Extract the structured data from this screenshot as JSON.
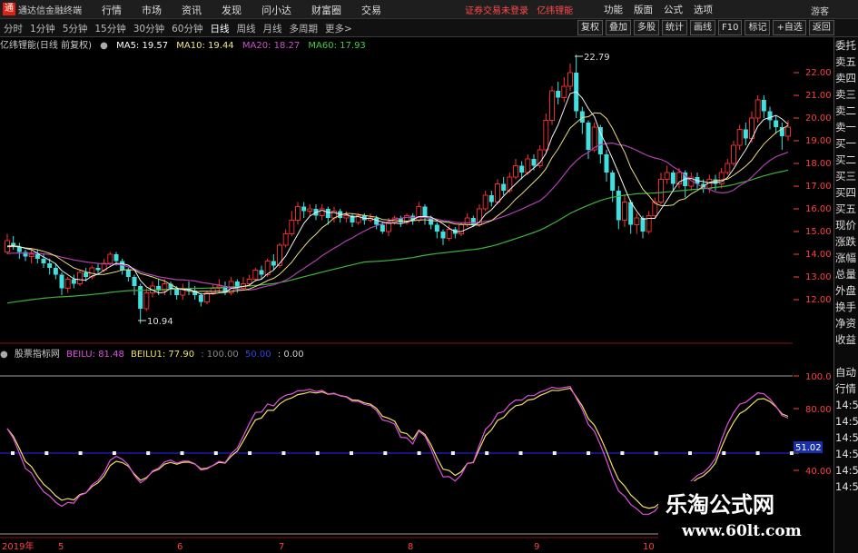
{
  "window": {
    "app_title": "通达信金融终端",
    "menus": [
      "行情",
      "市场",
      "资讯",
      "发现",
      "问小达",
      "财富圈",
      "交易"
    ],
    "warning": "证券交易未登录",
    "stock_name": "亿纬锂能",
    "right_menus": [
      "功能",
      "版面",
      "公式",
      "选项"
    ],
    "guest": "游客"
  },
  "toolbar": {
    "periods": [
      "分时",
      "1分钟",
      "5分钟",
      "15分钟",
      "30分钟",
      "60分钟",
      "日线",
      "周线",
      "月线",
      "多周期",
      "更多>"
    ],
    "active_period": "日线",
    "tools": [
      "复权",
      "叠加",
      "多股",
      "统计",
      "画线",
      "F10",
      "标记",
      "+自选",
      "返回"
    ]
  },
  "main_header": {
    "title": "亿纬锂能(日线 前复权)",
    "ma5": "MA5: 19.57",
    "ma10": "MA10: 19.44",
    "ma20": "MA20: 18.27",
    "ma60": "MA60: 17.93",
    "colors": {
      "ma5": "#ffffff",
      "ma10": "#f0e68c",
      "ma20": "#c040c0",
      "ma60": "#40c040"
    }
  },
  "price_axis": [
    "22.00",
    "21.00",
    "20.00",
    "19.00",
    "18.00",
    "17.00",
    "16.00",
    "15.00",
    "14.00",
    "13.00",
    "12.00"
  ],
  "price_labels": {
    "high": "22.79",
    "low": "10.94"
  },
  "indicator_header": {
    "name": "股票指标网",
    "beilu": "BEILU: 81.48",
    "beilu1": "BEILU1: 77.90",
    "v100": ": 100.00",
    "v50": "50.00",
    "v0": ": 0.00"
  },
  "indicator_axis": [
    "100.0",
    "80.00",
    "51.02",
    "40.00"
  ],
  "date_axis": [
    "2019年",
    "5",
    "6",
    "7",
    "8",
    "9",
    "10"
  ],
  "right_panel": [
    "委托",
    "卖五",
    "卖四",
    "卖三",
    "卖二",
    "卖一",
    "买一",
    "买二",
    "买三",
    "买四",
    "买五",
    "现价",
    "涨跌",
    "涨幅",
    "总量",
    "外盘",
    "换手",
    "净资",
    "收益",
    "",
    "自动",
    "行情",
    "14:50",
    "14:50",
    "14:50",
    "14:50",
    "14:50",
    "14:50",
    "14:50",
    "14:50"
  ],
  "watermark": {
    "line1": "乐淘公式网",
    "line2": "www.60lt.com"
  },
  "chart_data": {
    "type": "candlestick",
    "y_range": [
      11.3,
      23.0
    ],
    "candles": [
      [
        14.1,
        14.6,
        14.9,
        14.0
      ],
      [
        14.5,
        14.4,
        14.8,
        14.2
      ],
      [
        14.3,
        14.1,
        14.5,
        13.8
      ],
      [
        14.1,
        13.9,
        14.2,
        13.7
      ],
      [
        13.9,
        14.0,
        14.2,
        13.6
      ],
      [
        14.0,
        13.8,
        14.2,
        13.6
      ],
      [
        13.8,
        13.6,
        14.0,
        13.4
      ],
      [
        13.6,
        13.4,
        13.8,
        13.1
      ],
      [
        13.4,
        13.1,
        13.6,
        12.9
      ],
      [
        13.1,
        12.5,
        13.2,
        12.2
      ],
      [
        12.5,
        12.9,
        13.0,
        12.3
      ],
      [
        12.9,
        12.7,
        13.1,
        12.5
      ],
      [
        12.7,
        13.2,
        13.3,
        12.6
      ],
      [
        13.2,
        13.0,
        13.4,
        12.8
      ],
      [
        13.0,
        13.4,
        13.5,
        12.9
      ],
      [
        13.4,
        13.3,
        13.6,
        13.1
      ],
      [
        13.3,
        13.6,
        13.8,
        13.2
      ],
      [
        13.6,
        14.0,
        14.1,
        13.5
      ],
      [
        14.0,
        13.7,
        14.1,
        13.5
      ],
      [
        13.7,
        13.3,
        13.8,
        13.1
      ],
      [
        13.3,
        13.0,
        13.4,
        12.8
      ],
      [
        13.0,
        12.6,
        13.1,
        12.2
      ],
      [
        12.6,
        11.6,
        12.7,
        10.94
      ],
      [
        11.6,
        12.3,
        12.5,
        11.5
      ],
      [
        12.3,
        12.6,
        12.8,
        12.1
      ],
      [
        12.6,
        12.4,
        12.9,
        12.2
      ],
      [
        12.4,
        12.7,
        12.9,
        12.2
      ],
      [
        12.7,
        12.5,
        12.8,
        12.2
      ],
      [
        12.5,
        12.2,
        12.6,
        12.0
      ],
      [
        12.2,
        12.5,
        12.7,
        12.0
      ],
      [
        12.5,
        12.4,
        12.8,
        12.2
      ],
      [
        12.4,
        12.2,
        12.6,
        12.0
      ],
      [
        12.2,
        11.9,
        12.3,
        11.7
      ],
      [
        11.9,
        12.3,
        12.4,
        11.8
      ],
      [
        12.3,
        12.5,
        12.7,
        12.2
      ],
      [
        12.5,
        12.6,
        12.9,
        12.3
      ],
      [
        12.6,
        12.3,
        12.8,
        12.2
      ],
      [
        12.3,
        12.8,
        13.0,
        12.2
      ],
      [
        12.8,
        12.5,
        12.9,
        12.3
      ],
      [
        12.5,
        12.7,
        13.0,
        12.4
      ],
      [
        12.7,
        12.9,
        13.1,
        12.6
      ],
      [
        12.9,
        13.3,
        13.4,
        12.8
      ],
      [
        13.3,
        13.1,
        13.5,
        12.9
      ],
      [
        13.1,
        13.7,
        13.8,
        13.0
      ],
      [
        13.7,
        13.5,
        14.0,
        13.3
      ],
      [
        13.5,
        14.4,
        14.5,
        13.4
      ],
      [
        14.4,
        14.9,
        15.1,
        14.3
      ],
      [
        14.9,
        15.5,
        15.9,
        14.8
      ],
      [
        15.5,
        16.1,
        16.3,
        15.3
      ],
      [
        16.1,
        15.9,
        16.3,
        15.6
      ],
      [
        15.9,
        16.0,
        16.2,
        15.7
      ],
      [
        16.0,
        15.7,
        16.2,
        15.5
      ],
      [
        15.7,
        16.0,
        16.2,
        15.5
      ],
      [
        16.0,
        15.6,
        16.1,
        15.3
      ],
      [
        15.6,
        15.9,
        16.1,
        15.4
      ],
      [
        15.9,
        15.6,
        16.0,
        15.4
      ],
      [
        15.6,
        15.7,
        15.9,
        15.4
      ],
      [
        15.7,
        15.4,
        15.8,
        15.2
      ],
      [
        15.4,
        15.7,
        15.8,
        15.3
      ],
      [
        15.7,
        15.5,
        15.8,
        15.3
      ],
      [
        15.5,
        15.6,
        15.8,
        15.4
      ],
      [
        15.6,
        15.3,
        15.7,
        15.1
      ],
      [
        15.3,
        15.0,
        15.4,
        14.9
      ],
      [
        15.0,
        15.4,
        15.6,
        14.8
      ],
      [
        15.4,
        15.6,
        15.7,
        15.3
      ],
      [
        15.6,
        15.4,
        15.7,
        15.2
      ],
      [
        15.4,
        15.7,
        15.8,
        15.3
      ],
      [
        15.7,
        15.5,
        15.8,
        15.3
      ],
      [
        15.5,
        16.1,
        16.3,
        15.4
      ],
      [
        16.1,
        15.6,
        16.2,
        15.3
      ],
      [
        15.6,
        15.3,
        15.7,
        15.1
      ],
      [
        15.3,
        15.0,
        15.4,
        14.7
      ],
      [
        15.0,
        14.7,
        15.1,
        14.4
      ],
      [
        14.7,
        15.1,
        15.3,
        14.6
      ],
      [
        15.1,
        14.9,
        15.2,
        14.7
      ],
      [
        14.9,
        15.3,
        15.4,
        14.8
      ],
      [
        15.3,
        15.6,
        15.8,
        15.2
      ],
      [
        15.6,
        15.3,
        15.7,
        15.2
      ],
      [
        15.3,
        16.0,
        16.2,
        15.2
      ],
      [
        16.0,
        16.6,
        16.8,
        15.9
      ],
      [
        16.6,
        16.3,
        16.8,
        16.1
      ],
      [
        16.3,
        17.1,
        17.3,
        16.2
      ],
      [
        17.1,
        16.8,
        17.4,
        16.6
      ],
      [
        16.8,
        17.4,
        17.6,
        16.7
      ],
      [
        17.4,
        17.9,
        18.2,
        17.3
      ],
      [
        17.9,
        17.6,
        18.1,
        17.3
      ],
      [
        17.6,
        18.2,
        18.4,
        17.5
      ],
      [
        18.2,
        17.9,
        18.4,
        17.7
      ],
      [
        17.9,
        18.6,
        18.8,
        17.8
      ],
      [
        18.6,
        19.9,
        20.2,
        18.5
      ],
      [
        19.9,
        21.2,
        21.4,
        19.7
      ],
      [
        21.2,
        20.9,
        21.6,
        20.6
      ],
      [
        20.9,
        21.4,
        21.8,
        20.7
      ],
      [
        21.4,
        22.0,
        22.4,
        21.2
      ],
      [
        22.0,
        20.3,
        22.79,
        20.0
      ],
      [
        20.3,
        19.8,
        20.5,
        19.3
      ],
      [
        19.8,
        18.6,
        19.9,
        18.2
      ],
      [
        18.6,
        19.6,
        19.8,
        18.5
      ],
      [
        19.6,
        18.4,
        19.7,
        18.0
      ],
      [
        18.4,
        17.6,
        18.6,
        17.2
      ],
      [
        17.6,
        16.8,
        17.7,
        16.3
      ],
      [
        16.8,
        15.5,
        17.0,
        15.1
      ],
      [
        15.5,
        16.3,
        16.6,
        15.2
      ],
      [
        16.3,
        15.3,
        16.4,
        14.9
      ],
      [
        15.3,
        15.6,
        15.8,
        14.9
      ],
      [
        15.6,
        15.0,
        15.7,
        14.7
      ],
      [
        15.0,
        15.7,
        15.9,
        14.9
      ],
      [
        15.7,
        16.3,
        16.5,
        15.6
      ],
      [
        16.3,
        17.3,
        17.6,
        16.2
      ],
      [
        17.3,
        17.6,
        17.9,
        17.1
      ],
      [
        17.6,
        17.1,
        17.7,
        16.8
      ],
      [
        17.1,
        17.6,
        17.8,
        16.9
      ],
      [
        17.6,
        17.0,
        17.7,
        16.5
      ],
      [
        17.0,
        17.4,
        17.6,
        16.8
      ],
      [
        17.4,
        17.1,
        17.6,
        16.9
      ],
      [
        17.1,
        16.9,
        17.3,
        16.7
      ],
      [
        16.9,
        17.3,
        17.5,
        16.7
      ],
      [
        17.3,
        17.1,
        17.5,
        16.8
      ],
      [
        17.1,
        17.6,
        17.8,
        16.9
      ],
      [
        17.6,
        18.0,
        18.2,
        17.5
      ],
      [
        18.0,
        18.8,
        19.0,
        17.9
      ],
      [
        18.8,
        19.5,
        19.7,
        18.6
      ],
      [
        19.5,
        19.1,
        19.8,
        18.8
      ],
      [
        19.1,
        20.0,
        20.3,
        18.9
      ],
      [
        20.0,
        20.8,
        21.0,
        19.8
      ],
      [
        20.8,
        20.3,
        21.0,
        20.0
      ],
      [
        20.3,
        19.9,
        20.5,
        19.5
      ],
      [
        19.9,
        19.6,
        20.1,
        19.3
      ],
      [
        19.6,
        19.2,
        19.8,
        18.6
      ],
      [
        19.2,
        19.6,
        19.9,
        19.0
      ]
    ]
  }
}
